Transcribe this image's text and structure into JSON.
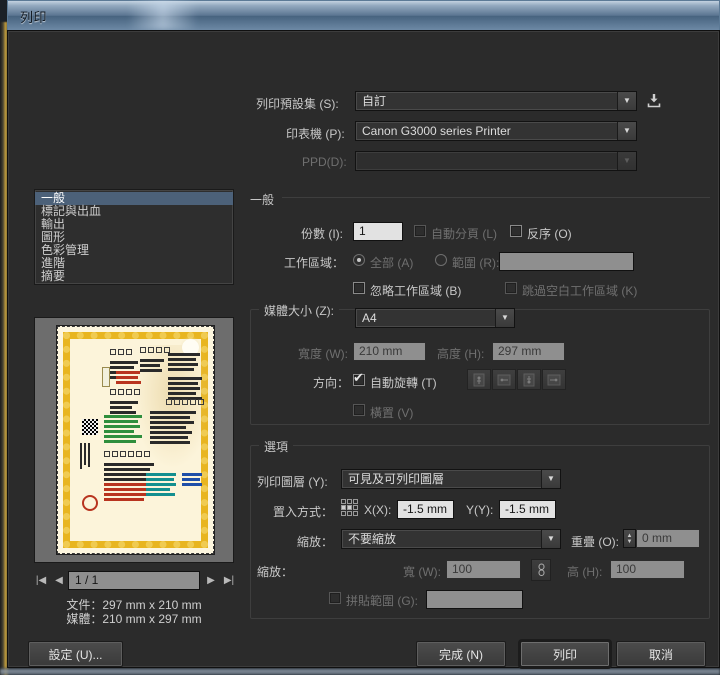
{
  "window": {
    "title": "列印"
  },
  "preset": {
    "label": "列印預設集 (S):",
    "value": "自訂",
    "save_icon": "save-preset-icon"
  },
  "printer": {
    "label": "印表機 (P):",
    "value": "Canon G3000 series Printer"
  },
  "ppd": {
    "label": "PPD(D):",
    "value": ""
  },
  "sidebar": {
    "items": [
      {
        "label": "一般",
        "active": true
      },
      {
        "label": "標記與出血",
        "active": false
      },
      {
        "label": "輸出",
        "active": false
      },
      {
        "label": "圖形",
        "active": false
      },
      {
        "label": "色彩管理",
        "active": false
      },
      {
        "label": "進階",
        "active": false
      },
      {
        "label": "摘要",
        "active": false
      }
    ]
  },
  "general": {
    "heading": "一般",
    "copies_label": "份數 (I):",
    "copies_value": "1",
    "collate_label": "自動分頁 (L)",
    "reverse_label": "反序 (O)",
    "artboard_label": "工作區域：",
    "all_label": "全部 (A)",
    "range_label": "範圍 (R):",
    "range_value": "",
    "ignore_artboards_label": "忽略工作區域 (B)",
    "skip_blank_label": "跳過空白工作區域 (K)"
  },
  "media": {
    "size_label": "媒體大小 (Z):",
    "size_value": "A4",
    "width_label": "寬度 (W):",
    "width_value": "210 mm",
    "height_label": "高度 (H):",
    "height_value": "297 mm",
    "orientation_label": "方向：",
    "auto_rotate_label": "自動旋轉 (T)",
    "transverse_label": "橫置 (V)",
    "orient_buttons": [
      "orientation-portrait-icon",
      "orientation-landscape-icon",
      "orientation-portrait-flipped-icon",
      "orientation-landscape-flipped-icon"
    ]
  },
  "options": {
    "heading": "選項",
    "print_layers_label": "列印圖層 (Y):",
    "print_layers_value": "可見及可列印圖層",
    "placement_label": "置入方式：",
    "placement_icon": "placement-grid-icon",
    "x_label": "X(X):",
    "x_value": "-1.5 mm",
    "y_label": "Y(Y):",
    "y_value": "-1.5 mm",
    "scaling_label": "縮放：",
    "scaling_value": "不要縮放",
    "overlap_label": "重疊 (O):",
    "overlap_value": "0 mm",
    "scale_label": "縮放：",
    "scale_w_label": "寬 (W):",
    "scale_w_value": "100",
    "link_icon": "link-constrain-icon",
    "scale_h_label": "高 (H):",
    "scale_h_value": "100",
    "tile_range_label": "拼貼範圍 (G):",
    "tile_range_value": ""
  },
  "pagenav": {
    "first_icon": "first-page-icon",
    "prev_icon": "previous-page-icon",
    "page_value": "1 / 1",
    "next_icon": "next-page-icon",
    "last_icon": "last-page-icon",
    "document_info": "文件：297 mm x 210 mm",
    "media_info": "媒體：210 mm x 297 mm"
  },
  "footer": {
    "setup": "設定 (U)...",
    "done": "完成 (N)",
    "print": "列印",
    "cancel": "取消"
  },
  "colors": {
    "dialog_bg": "#2b2b2b",
    "accent_selected": "#4c6179",
    "titlebar": "#5b7591",
    "field_bg": "#b9b9b9"
  }
}
